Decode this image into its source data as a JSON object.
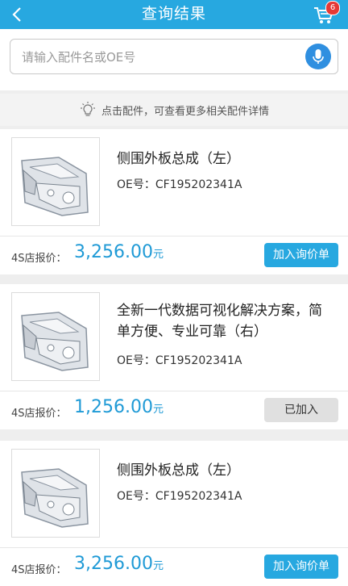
{
  "header": {
    "title": "查询结果",
    "cart_count": "6"
  },
  "search": {
    "placeholder": "请输入配件名或OE号"
  },
  "tip": {
    "text": "点击配件，可查看更多相关配件详情"
  },
  "items": [
    {
      "name": "侧围外板总成（左）",
      "oe": "OE号：CF195202341A",
      "price_label": "4S店报价：",
      "price": "3,256.00",
      "unit": "元",
      "button": "加入询价单",
      "added": false
    },
    {
      "name": "全新一代数据可视化解决方案，简单方便、专业可靠（右）",
      "oe": "OE号：CF195202341A",
      "price_label": "4S店报价：",
      "price": "1,256.00",
      "unit": "元",
      "button": "已加入",
      "added": true
    },
    {
      "name": "侧围外板总成（左）",
      "oe": "OE号：CF195202341A",
      "price_label": "4S店报价：",
      "price": "3,256.00",
      "unit": "元",
      "button": "加入询价单",
      "added": false
    }
  ],
  "colors": {
    "accent": "#27a8e0",
    "price": "#1f9ad6",
    "badge": "#e53935"
  }
}
